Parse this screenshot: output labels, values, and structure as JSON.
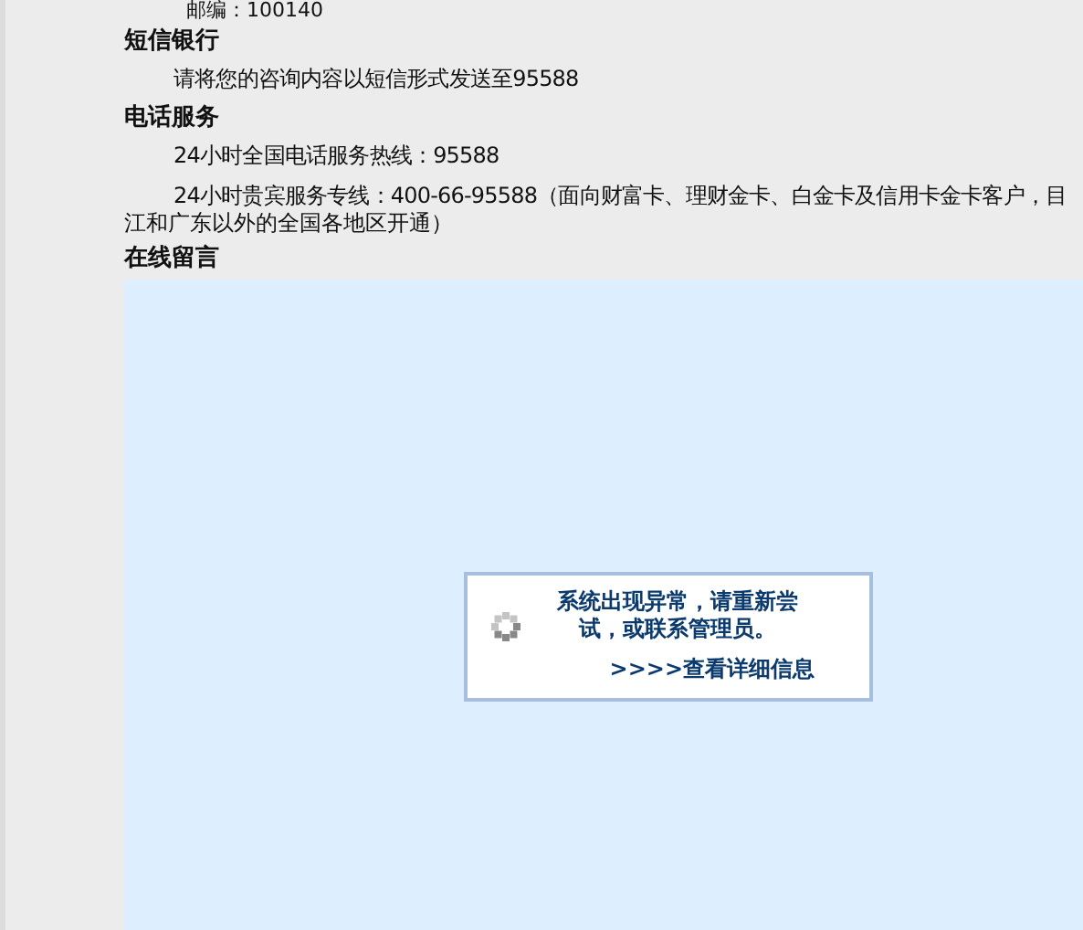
{
  "postal_line": "邮编：100140",
  "sections": [
    {
      "title": "短信银行",
      "lines": [
        "请将您的咨询内容以短信形式发送至95588"
      ]
    },
    {
      "title": "电话服务",
      "lines": [
        "24小时全国电话服务热线：95588",
        "24小时贵宾服务专线：400-66-95588（面向财富卡、理财金卡、白金卡及信用卡金卡客户，目"
      ],
      "continuation": "江和广东以外的全国各地区开通）"
    },
    {
      "title": "在线留言"
    }
  ],
  "error_dialog": {
    "message": "系统出现异常，请重新尝试，或联系管理员。",
    "details_link": ">>>>查看详细信息"
  }
}
